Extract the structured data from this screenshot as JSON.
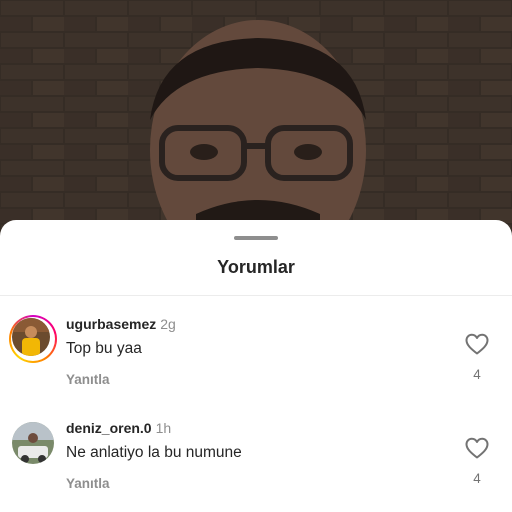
{
  "sheet": {
    "title": "Yorumlar"
  },
  "comments": [
    {
      "username": "ugurbasemez",
      "time": "2g",
      "text": "Top bu yaa",
      "reply_label": "Yanıtla",
      "like_count": "4",
      "avatar_story_ring": true
    },
    {
      "username": "deniz_oren.0",
      "time": "1h",
      "text": "Ne anlatiyo la bu numune",
      "reply_label": "Yanıtla",
      "like_count": "4",
      "avatar_story_ring": false
    }
  ],
  "icons": {
    "like": "heart-outline-icon"
  },
  "colors": {
    "sheet_bg": "#ffffff",
    "primary_text": "#262626",
    "secondary_text": "#8e8e8e",
    "story_ring": [
      "#d300c5",
      "#ff0069",
      "#ff7a00",
      "#ffd600"
    ]
  }
}
